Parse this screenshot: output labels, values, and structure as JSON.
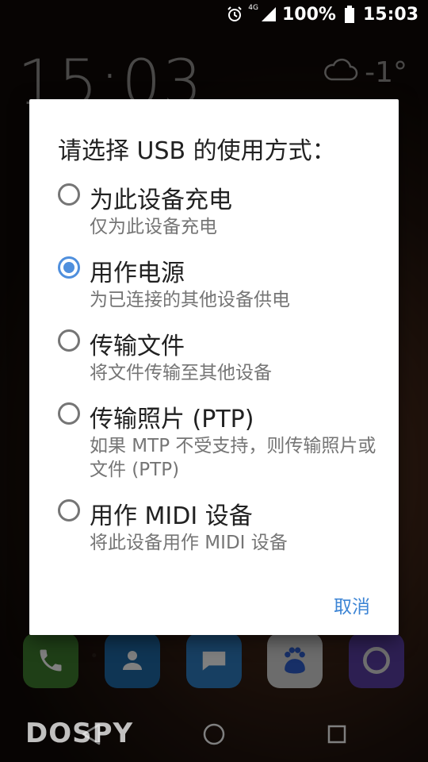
{
  "status_bar": {
    "network_label": "4G",
    "battery_percent": "100%",
    "time": "15:03"
  },
  "home": {
    "clock": "15:03",
    "temperature": "-1°"
  },
  "dialog": {
    "title": "请选择 USB 的使用方式：",
    "options": [
      {
        "title": "为此设备充电",
        "description": "仅为此设备充电",
        "checked": false
      },
      {
        "title": "用作电源",
        "description": "为已连接的其他设备供电",
        "checked": true
      },
      {
        "title": "传输文件",
        "description": "将文件传输至其他设备",
        "checked": false
      },
      {
        "title": "传输照片 (PTP)",
        "description": "如果 MTP 不受支持，则传输照片或文件 (PTP)",
        "checked": false
      },
      {
        "title": "用作 MIDI 设备",
        "description": "将此设备用作 MIDI 设备",
        "checked": false
      }
    ],
    "cancel_label": "取消"
  },
  "dock": {
    "apps": [
      "phone-icon",
      "contacts-icon",
      "messages-icon",
      "baidu-icon",
      "circle-app-icon"
    ]
  },
  "watermark": "DOSPY",
  "colors": {
    "accent": "#4f8fdd",
    "cancel": "#3d85d5",
    "title_text": "#212121",
    "desc_text": "#757575"
  }
}
